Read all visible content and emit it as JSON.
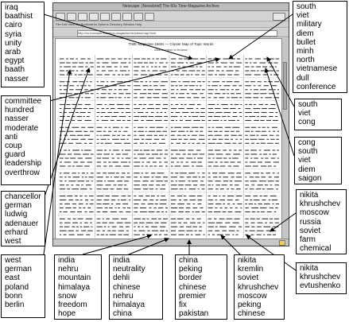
{
  "browser": {
    "title": "Netscape: [Newsbrief] The 60s Time-Magazine Archive",
    "menu": "File  Edit  View  Go  Bookmarks  Options  Directory  Window  Help",
    "url": "http://cs.example.edu/time-magazine/clusters/map.html",
    "doc_title": "TIME Magazine 1960s — Cluster Map of Topic Words",
    "doc_subtitle": "click a region to browse"
  },
  "keyword_groups": [
    {
      "id": "iraq",
      "words": [
        "iraq",
        "baathist",
        "cairo",
        "syria",
        "unity",
        "arab",
        "egypt",
        "baath",
        "nasser"
      ]
    },
    {
      "id": "committee",
      "words": [
        "committee",
        "hundred",
        "nasser",
        "moderate",
        "anti",
        "coup",
        "guard",
        "leadership",
        "overthrow"
      ]
    },
    {
      "id": "chancellor",
      "words": [
        "chancellor",
        "german",
        "ludwig",
        "adenauer",
        "erhard",
        "west"
      ]
    },
    {
      "id": "west-german",
      "words": [
        "west",
        "german",
        "east",
        "poland",
        "bonn",
        "berlin"
      ]
    },
    {
      "id": "india-nehru",
      "words": [
        "india",
        "nehru",
        "mountain",
        "himalaya",
        "snow",
        "freedom",
        "hope"
      ]
    },
    {
      "id": "india-neutral",
      "words": [
        "india",
        "neutrality",
        "dehli",
        "chinese",
        "nehru",
        "himalaya",
        "china"
      ]
    },
    {
      "id": "china-peking",
      "words": [
        "china",
        "peking",
        "border",
        "chinese",
        "premier",
        "fix",
        "pakistan"
      ]
    },
    {
      "id": "nikita-kremlin",
      "words": [
        "nikita",
        "kremlin",
        "soviet",
        "khrushchev",
        "moscow",
        "peking",
        "chinese"
      ]
    },
    {
      "id": "south-viet",
      "words": [
        "south",
        "viet",
        "military",
        "diem",
        "bullet",
        "minh",
        "north",
        "vietnamese",
        "dull",
        "conference"
      ]
    },
    {
      "id": "south-cong",
      "words": [
        "south",
        "viet",
        "cong"
      ]
    },
    {
      "id": "cong-saigon",
      "words": [
        "cong",
        "south",
        "viet",
        "diem",
        "saigon"
      ]
    },
    {
      "id": "nikita-farm",
      "words": [
        "nikita",
        "khrushchev",
        "moscow",
        "russia",
        "soviet",
        "farm",
        "chemical"
      ]
    },
    {
      "id": "nikita-evtu",
      "words": [
        "nikita",
        "khrushchev",
        "evtushenko"
      ]
    }
  ],
  "colors": {
    "arrow": "#000000",
    "window_frame": "#d9d9d9",
    "content_bg": "#ffffff"
  }
}
